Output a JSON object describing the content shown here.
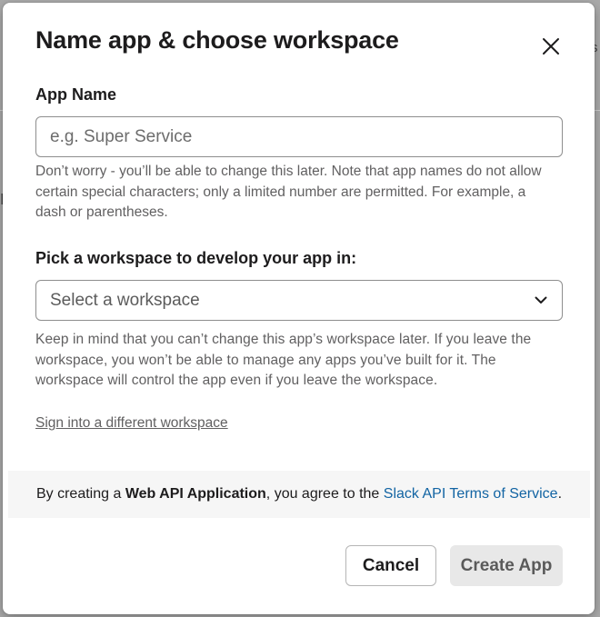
{
  "background": {
    "snippet_right": "s",
    "snippet_left": "r"
  },
  "modal": {
    "title": "Name app & choose workspace",
    "close_icon": "close-icon"
  },
  "app_name": {
    "label": "App Name",
    "placeholder": "e.g. Super Service",
    "value": "",
    "hint": "Don’t worry - you’ll be able to change this later. Note that app names do not allow certain special characters; only a limited number are permitted. For example, a dash or parentheses."
  },
  "workspace": {
    "label": "Pick a workspace to develop your app in:",
    "selected": "Select a workspace",
    "chevron_icon": "chevron-down-icon",
    "hint": "Keep in mind that you can’t change this app’s workspace later. If you leave the workspace, you won’t be able to manage any apps you’ve built for it. The workspace will control the app even if you leave the workspace.",
    "sign_in_link": "Sign into a different workspace"
  },
  "terms": {
    "prefix": "By creating a ",
    "app_type": "Web API Application",
    "middle": ", you agree to the ",
    "link": "Slack API Terms of Service",
    "suffix": "."
  },
  "footer": {
    "cancel_label": "Cancel",
    "create_label": "Create App"
  },
  "colors": {
    "link": "#1264a3",
    "text": "#1d1c1d",
    "hint": "#616061"
  }
}
